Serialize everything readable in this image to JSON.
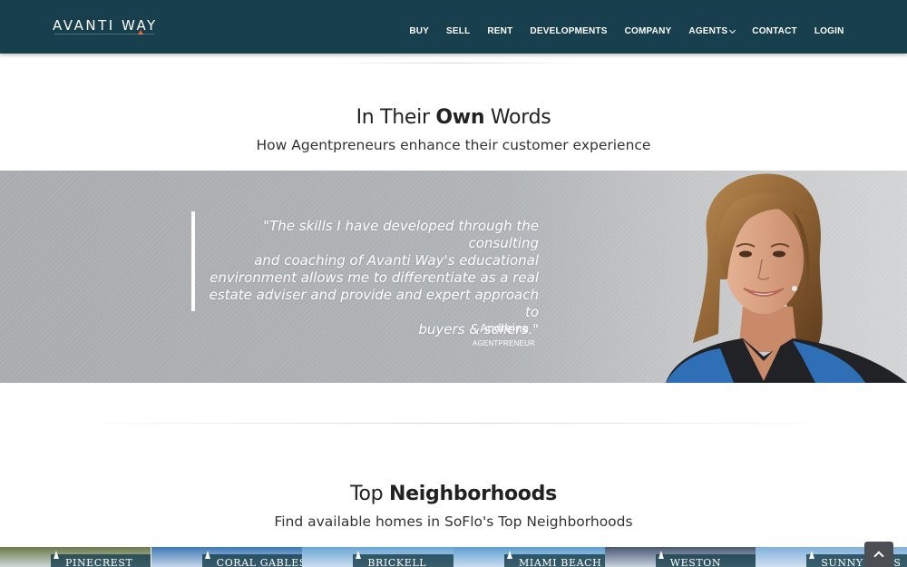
{
  "brand": {
    "name": "AVANTI WAY"
  },
  "nav": {
    "items": [
      {
        "label": "BUY"
      },
      {
        "label": "SELL"
      },
      {
        "label": "RENT"
      },
      {
        "label": "DEVELOPMENTS"
      },
      {
        "label": "COMPANY"
      },
      {
        "label": "AGENTS"
      },
      {
        "label": "CONTACT"
      },
      {
        "label": "LOGIN"
      }
    ]
  },
  "testimonials": {
    "title_pre": "In Their ",
    "title_bold": "Own",
    "title_post": " Words",
    "subtitle": "How Agentpreneurs enhance their customer experience",
    "quote_lines": [
      "\"The skills I have developed through the consulting",
      "and coaching of Avanti Way's educational",
      "environment allows me to differentiate as a real",
      "estate adviser and provide and expert approach to",
      "buyers & sellers.\""
    ],
    "author": "- Andreina",
    "role": "AGENTPRENEUR"
  },
  "neighborhoods": {
    "title_pre": "Top ",
    "title_bold": "Neighborhoods",
    "subtitle": "Find available homes in SoFlo's Top Neighborhoods",
    "items": [
      {
        "name": "PINECREST",
        "color": "#6b7a4a"
      },
      {
        "name": "CORAL GABLES",
        "color": "#3f79b8"
      },
      {
        "name": "BRICKELL",
        "color": "#6aa6d6"
      },
      {
        "name": "MIAMI BEACH",
        "color": "#5d9fd4"
      },
      {
        "name": "WESTON",
        "color": "#4a5872"
      },
      {
        "name": "SUNNY ISLES",
        "color": "#7fb0dc"
      }
    ]
  },
  "colors": {
    "nav_bg": "#173f4d",
    "accent": "#e3632c"
  }
}
